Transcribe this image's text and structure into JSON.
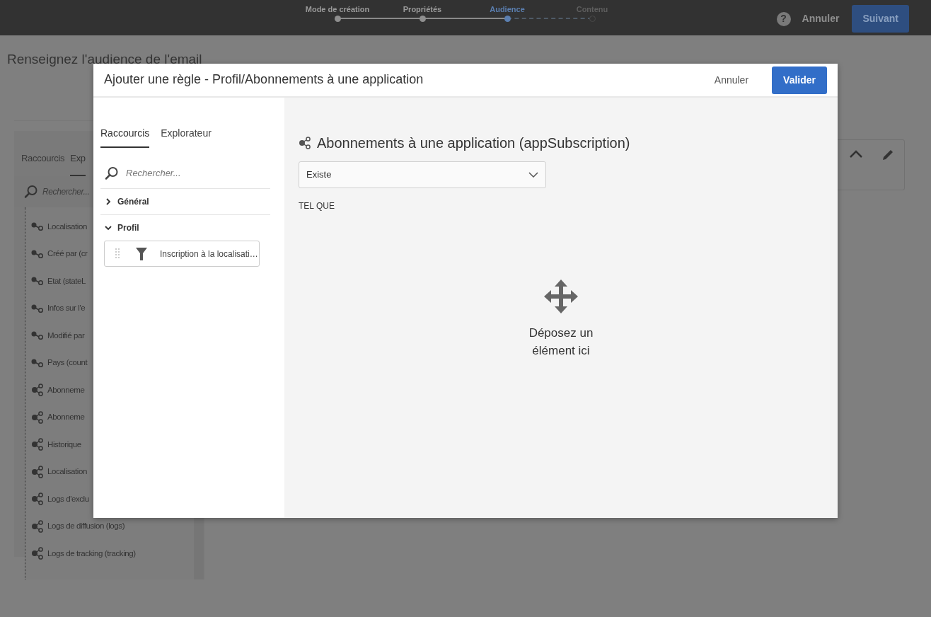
{
  "top_bar": {
    "steps": [
      {
        "label": "Mode de création",
        "completed": true,
        "selected": false
      },
      {
        "label": "Propriétés",
        "completed": true,
        "selected": false
      },
      {
        "label": "Audience",
        "completed": false,
        "selected": true
      },
      {
        "label": "Contenu",
        "completed": false,
        "selected": false
      }
    ],
    "help": "?",
    "buttons": [
      {
        "label": "Annuler",
        "kind": "link"
      },
      {
        "label": "Suivant",
        "kind": "primary"
      }
    ]
  },
  "page": {
    "heading": "Renseignez l'audience de l'email",
    "explorer": {
      "tabs": [
        {
          "label": "Raccourcis",
          "selected": false
        },
        {
          "label": "Exp",
          "selected": true
        }
      ],
      "search": {
        "placeholder": "Rechercher..."
      },
      "items": [
        {
          "label": "Localisation",
          "kind": "link"
        },
        {
          "label": "Créé par (cr",
          "kind": "link"
        },
        {
          "label": "Etat (stateL",
          "kind": "link"
        },
        {
          "label": "Infos sur l'e",
          "kind": "link"
        },
        {
          "label": "Modifié par",
          "kind": "link"
        },
        {
          "label": "Pays (count",
          "kind": "link"
        },
        {
          "label": "Abonneme",
          "kind": "collection"
        },
        {
          "label": "Abonneme",
          "kind": "collection"
        },
        {
          "label": "Historique",
          "kind": "collection"
        },
        {
          "label": "Localisation",
          "kind": "collection"
        },
        {
          "label": "Logs d'exclu",
          "kind": "collection"
        },
        {
          "label": "Logs de diffusion (logs)",
          "kind": "collection"
        },
        {
          "label": "Logs de tracking (tracking)",
          "kind": "collection"
        }
      ]
    }
  },
  "dialog": {
    "title": "Ajouter une règle - Profil/Abonnements à une application",
    "buttons": [
      {
        "label": "Annuler",
        "kind": "link"
      },
      {
        "label": "Valider",
        "kind": "primary"
      }
    ],
    "tabs": [
      {
        "label": "Raccourcis",
        "selected": true
      },
      {
        "label": "Explorateur",
        "selected": false
      }
    ],
    "search": {
      "placeholder": "Rechercher..."
    },
    "sections": [
      {
        "label": "Général",
        "expanded": false
      },
      {
        "label": "Profil",
        "expanded": true,
        "items": [
          {
            "label": "Inscription à la localisati…"
          }
        ]
      }
    ],
    "rule": {
      "title": "Abonnements à une application (appSubscription)",
      "operator": "Existe",
      "condition_label": "TEL QUE",
      "drop_text": "Déposez un élément ici"
    }
  }
}
